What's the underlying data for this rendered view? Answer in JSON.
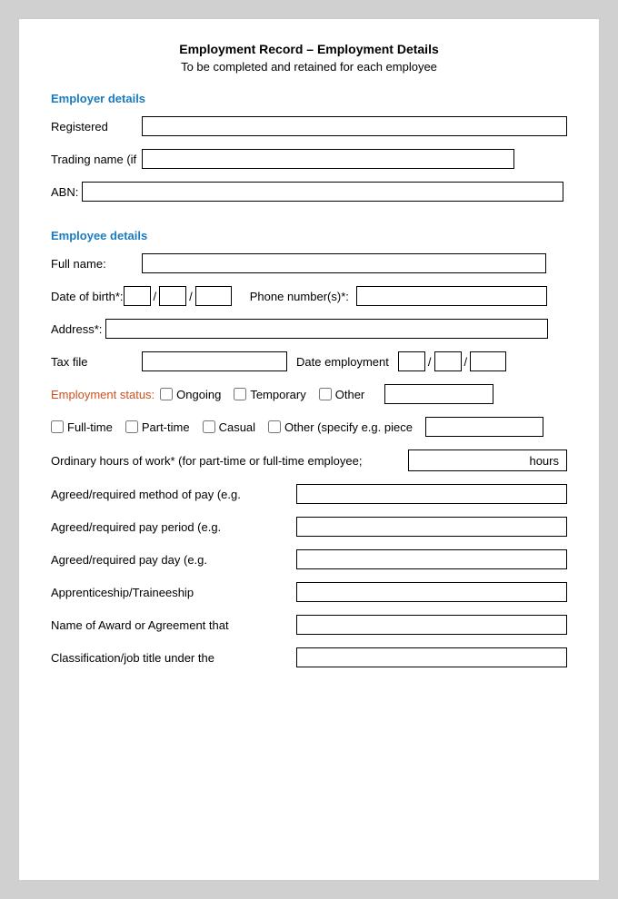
{
  "header": {
    "title": "Employment Record – Employment Details",
    "subtitle": "To be completed and retained for each employee"
  },
  "employer_section": {
    "heading": "Employer details",
    "registered_label": "Registered",
    "trading_label": "Trading name (if",
    "abn_label": "ABN:"
  },
  "employee_section": {
    "heading": "Employee details",
    "fullname_label": "Full name:",
    "dob_label": "Date of birth*:",
    "phone_label": "Phone number(s)*:",
    "address_label": "Address*:",
    "tax_label": "Tax file",
    "date_employ_label": "Date employment",
    "status_label": "Employment status:",
    "status_ongoing": "Ongoing",
    "status_temporary": "Temporary",
    "status_other": "Other",
    "fulltime_label": "Full-time",
    "parttime_label": "Part-time",
    "casual_label": "Casual",
    "other_specify_label": "Other (specify e.g. piece",
    "ordinary_hours_label": "Ordinary hours of work* (for part-time or full-time employee;",
    "hours_suffix": "hours",
    "agreed_pay_method_label": "Agreed/required method of pay (e.g.",
    "agreed_pay_period_label": "Agreed/required pay period (e.g.",
    "agreed_pay_day_label": "Agreed/required pay day (e.g.",
    "apprenticeship_label": "Apprenticeship/Traineeship",
    "award_label": "Name of Award or Agreement that",
    "classification_label": "Classification/job title under the"
  }
}
